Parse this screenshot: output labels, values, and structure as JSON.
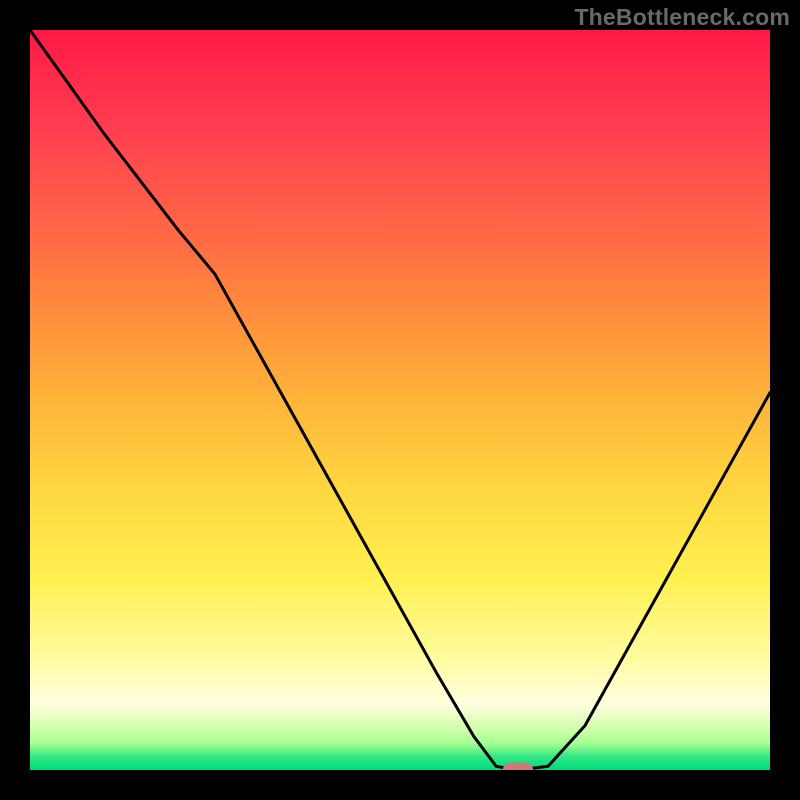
{
  "watermark": "TheBottleneck.com",
  "chart_data": {
    "type": "line",
    "title": "",
    "xlabel": "",
    "ylabel": "",
    "xlim": [
      0,
      100
    ],
    "ylim": [
      0,
      100
    ],
    "x": [
      0,
      5,
      10,
      15,
      20,
      25,
      30,
      35,
      40,
      45,
      50,
      55,
      60,
      63,
      66,
      70,
      75,
      80,
      85,
      90,
      95,
      100
    ],
    "values": [
      100,
      93,
      86,
      79.5,
      73,
      67,
      58,
      49,
      40,
      31,
      22,
      13,
      4.5,
      0.5,
      0,
      0.5,
      6,
      15,
      24,
      33,
      42,
      51
    ],
    "marker": {
      "x": 66,
      "y": 0
    },
    "background_gradient": {
      "top": "#ff1846",
      "mid": "#ffd740",
      "bottom": "#00dc7d"
    },
    "colors": {
      "curve": "#000000",
      "marker": "#cf7a78",
      "frame": "#000000"
    }
  }
}
